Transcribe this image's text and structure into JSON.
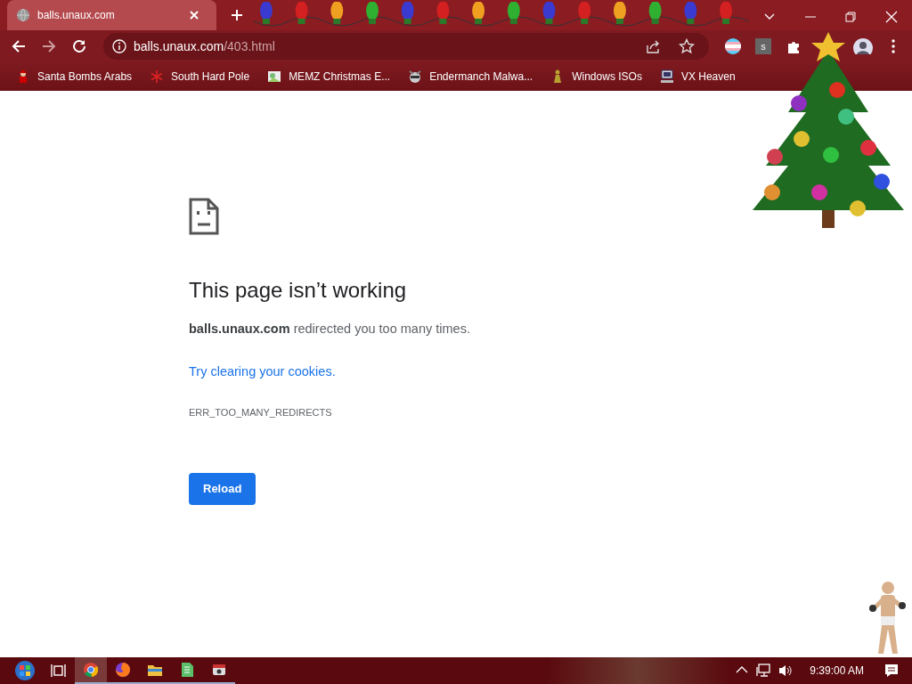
{
  "browser": {
    "tab": {
      "title": "balls.unaux.com",
      "selected": true
    },
    "address": {
      "host": "balls.unaux.com",
      "path": "/403.html"
    },
    "extensions": [
      {
        "kind": "flag"
      },
      {
        "kind": "letter",
        "text": "s"
      },
      {
        "kind": "puzzle"
      }
    ],
    "bookmarks": [
      {
        "label": "Santa Bombs Arabs",
        "kind": "santa"
      },
      {
        "label": "South Hard Pole",
        "kind": "snowflake"
      },
      {
        "label": "MEMZ Christmas E...",
        "kind": "image"
      },
      {
        "label": "Endermanch Malwa...",
        "kind": "raccoon"
      },
      {
        "label": "Windows ISOs",
        "kind": "figure"
      },
      {
        "label": "VX Heaven",
        "kind": "computer"
      }
    ]
  },
  "error_page": {
    "title": "This page isn’t working",
    "message": "**balls.unaux.com** redirected you too many times.",
    "suggestion": "Try clearing your cookies.",
    "code": "ERR_TOO_MANY_REDIRECTS",
    "button": "Reload"
  },
  "taskbar": {
    "apps": [
      {
        "kind": "chrome",
        "active": true
      },
      {
        "kind": "firefox",
        "active": false
      },
      {
        "kind": "folder",
        "active": false
      },
      {
        "kind": "sheet",
        "active": false
      },
      {
        "kind": "app",
        "active": false
      }
    ],
    "clock": "9:39:00 AM"
  }
}
